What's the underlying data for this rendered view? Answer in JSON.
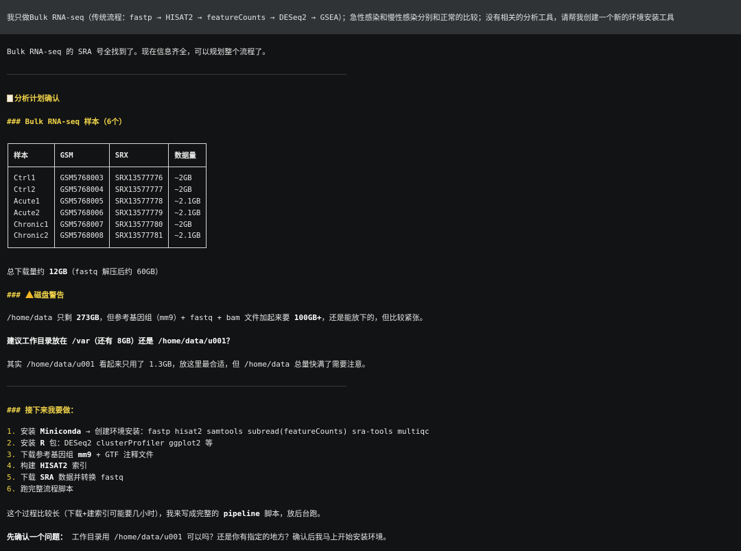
{
  "user_message": "我只做Bulk RNA-seq（传统流程：fastp → HISAT2 → featureCounts → DESeq2 → GSEA）；急性感染和慢性感染分别和正常的比较；没有相关的分析工具，请帮我创建一个新的环境安装工具",
  "intro": "Bulk RNA-seq 的 SRA 号全找到了。现在信息齐全，可以规划整个流程了。",
  "plan_heading": "分析计划确认",
  "samples_heading": "### Bulk RNA-seq 样本（6个）",
  "table": {
    "headers": [
      "样本",
      "GSM",
      "SRX",
      "数据量"
    ],
    "rows": [
      [
        "Ctrl1",
        "GSM5768003",
        "SRX13577776",
        "~2GB"
      ],
      [
        "Ctrl2",
        "GSM5768004",
        "SRX13577777",
        "~2GB"
      ],
      [
        "Acute1",
        "GSM5768005",
        "SRX13577778",
        "~2.1GB"
      ],
      [
        "Acute2",
        "GSM5768006",
        "SRX13577779",
        "~2.1GB"
      ],
      [
        "Chronic1",
        "GSM5768007",
        "SRX13577780",
        "~2GB"
      ],
      [
        "Chronic2",
        "GSM5768008",
        "SRX13577781",
        "~2.1GB"
      ]
    ]
  },
  "download_total": {
    "prefix": "总下载量约 ",
    "bold": "12GB",
    "suffix": "（fastq 解压后约 60GB）"
  },
  "disk_heading": {
    "hashes": "### ",
    "text": "磁盘警告"
  },
  "disk_line": {
    "p1": "/home/data 只剩 ",
    "b1": "273GB",
    "p2": "，但参考基因组（mm9）+ fastq + bam 文件加起来要 ",
    "b2": "100GB+",
    "p3": "，还是能放下的，但比较紧张。"
  },
  "suggest_line": "建议工作目录放在 /var（还有 8GB）还是 /home/data/u001？",
  "note_line": "其实 /home/data/u001 看起来只用了 1.3GB，放这里最合适，但 /home/data 总量快满了需要注意。",
  "next_heading": "### 接下来我要做：",
  "steps": [
    {
      "num": "1.",
      "lead": "安装 ",
      "bold": "Miniconda",
      "rest": " → 创建环境安装：fastp hisat2 samtools subread(featureCounts) sra-tools multiqc"
    },
    {
      "num": "2.",
      "lead": "安装 ",
      "bold": "R",
      "rest": " 包：DESeq2 clusterProfiler ggplot2 等"
    },
    {
      "num": "3.",
      "lead": "下载参考基因组 ",
      "bold": "mm9",
      "rest": " + GTF 注释文件"
    },
    {
      "num": "4.",
      "lead": "构建 ",
      "bold": "HISAT2",
      "rest": " 索引"
    },
    {
      "num": "5.",
      "lead": "下载 ",
      "bold": "SRA",
      "rest": " 数据并转换 fastq"
    },
    {
      "num": "6.",
      "lead": "跑完整流程脚本",
      "bold": "",
      "rest": ""
    }
  ],
  "process_line": {
    "prefix": "这个过程比较长（下载+建索引可能要几小时），我来写成完整的 ",
    "bold": "pipeline",
    "suffix": " 脚本，放后台跑。"
  },
  "confirm_line": {
    "bold": "先确认一个问题：",
    "rest": "  工作目录用 /home/data/u001 可以吗？还是你有指定的地方？确认后我马上开始安装环境。"
  }
}
